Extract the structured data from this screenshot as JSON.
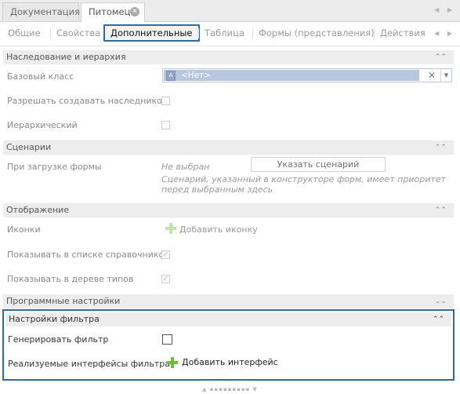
{
  "doc_tabs": [
    {
      "label": "Документация"
    },
    {
      "label": "Питомец"
    }
  ],
  "doc_nav": "◀ ▶",
  "prop_tabs": {
    "items": [
      "Общие",
      "Свойства",
      "Дополнительные",
      "Таблица",
      "Формы (представления)",
      "Действия"
    ],
    "active": "Дополнительные",
    "nav": "◀ ▶"
  },
  "sections": {
    "inheritance": {
      "title": "Наследование и иерархия",
      "base_class_label": "Базовый класс",
      "base_class_value": "<Нет>",
      "allow_inherit_label": "Разрешать создавать наследников",
      "hierarchical_label": "Иерархический"
    },
    "scenarios": {
      "title": "Сценарии",
      "on_load_label": "При загрузке формы",
      "not_selected": "Не выбран",
      "button": "Указать сценарий",
      "hint": "Сценарий, указанный в конструкторе форм, имеет приоритет перед выбранным здесь"
    },
    "display": {
      "title": "Отображение",
      "icons_label": "Иконки",
      "add_icon": "Добавить иконку",
      "show_in_catalog_label": "Показывать в списке справочников",
      "show_in_tree_label": "Показывать в дереве типов"
    },
    "program": {
      "title": "Программные настройки"
    },
    "filter": {
      "title": "Настройки фильтра",
      "generate_label": "Генерировать фильтр",
      "interfaces_label": "Реализуемые интерфейсы фильтра",
      "add_interface": "Добавить интерфейс"
    }
  },
  "chevrons": {
    "up": "⌃⌃",
    "down": "⌄⌄"
  },
  "colors": {
    "accent": "#2d6da3",
    "plus_green": "#6cbf3b",
    "plus_pale": "#bfe3a8"
  }
}
